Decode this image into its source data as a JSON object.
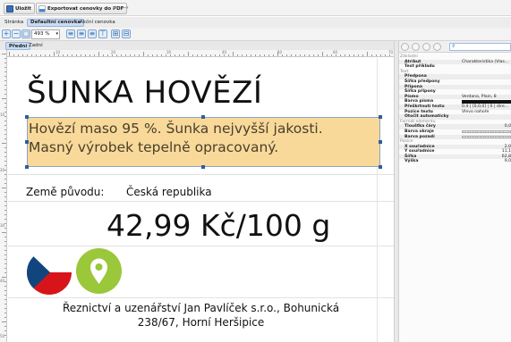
{
  "toolbar": {
    "save_label": "Uložit",
    "export_label": "Exportovat cenovky do PDF"
  },
  "tabs": [
    {
      "label": "Stránka"
    },
    {
      "label": "Defaultní cenovka"
    },
    {
      "label": "Akční cenovka"
    }
  ],
  "zoom": {
    "value": "493 %"
  },
  "subtabs": [
    {
      "label": "Přední"
    },
    {
      "label": "Zadní"
    }
  ],
  "ruler": {
    "top": [
      "10",
      "20",
      "30",
      "40",
      "50",
      "60",
      "70"
    ],
    "left": [
      "10",
      "20",
      "30",
      "40",
      "50"
    ]
  },
  "label": {
    "title": "ŠUNKA HOVĚZÍ",
    "description_line1": "Hovězí maso 95 %. Šunka nejvyšší jakosti.",
    "description_line2": "Masný výrobek tepelně opracovaný.",
    "origin_label": "Země původu:",
    "origin_value": "Česká republika",
    "price": "42,99 Kč/100 g",
    "maker_line1": "Řeznictví a uzenářství Jan Pavlíček s.r.o., Bohunická",
    "maker_line2": "238/67, Horní Heršipice"
  },
  "properties": {
    "section_basic": "Základní",
    "col_attribute": "Atribut",
    "col_attribute_value": "Charakteristika (Vlas...",
    "example_text_label": "Text příkladu",
    "section_text": "Text",
    "prefix": "Předpona",
    "prefix_width": "Šířka předpony",
    "suffix": "Přípona",
    "suffix_width": "Šířka přípony",
    "font_label": "Písmo",
    "font_value": "Verdana, Plain, 8",
    "font_color": "Barva písma",
    "strike": "Přeškrtnutí textu",
    "strike_value": "0.4 | [0,0,0] | 0 | dire...",
    "text_position": "Pozice textu",
    "text_position_value": "Vlevo nahoře",
    "auto_rotate": "Otočit automaticky",
    "section_format": "Formát elementu",
    "line_thickness": "Tloušťka čáry",
    "line_thickness_value": "0,0",
    "border_color": "Barva okraje",
    "bg_color": "Barva pozadí",
    "section_position": "Pozice",
    "x_label": "X souřadnice",
    "x_value": "2,0",
    "y_label": "Y souřadnice",
    "y_value": "11,1",
    "w_label": "Šířka",
    "w_value": "62,8",
    "h_label": "Výška",
    "h_value": "9,0"
  },
  "colors": {
    "description_bg": "#f8d99a",
    "pin_green": "#9bc73a",
    "accent_blue": "#2a6bb5"
  },
  "icons": [
    "save-icon",
    "pdf-export-icon",
    "zoom-in-icon",
    "zoom-out-icon",
    "zoom-fit-icon",
    "location-pin-icon",
    "czech-flag-icon",
    "search-icon"
  ]
}
